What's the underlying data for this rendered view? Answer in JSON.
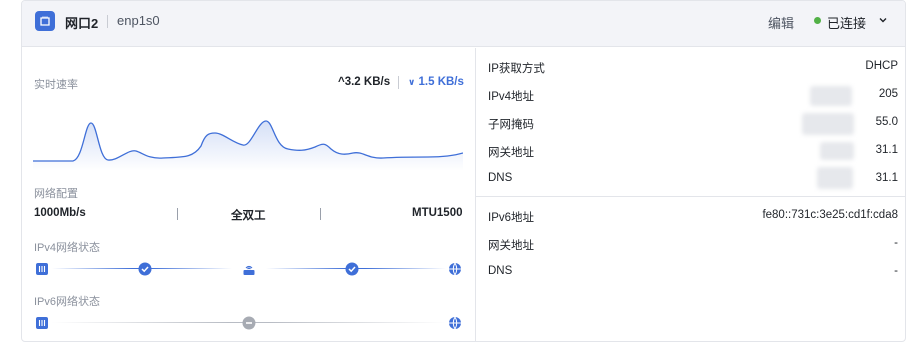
{
  "header": {
    "title": "网口2",
    "interface": "enp1s0",
    "edit_label": "编辑",
    "status_label": "已连接",
    "status_color": "#52b146",
    "accent_color": "#3f6fd8"
  },
  "speed": {
    "label": "实时速率",
    "upload": "3.2 KB/s",
    "download": "1.5 KB/s"
  },
  "config": {
    "label": "网络配置",
    "speed": "1000Mb/s",
    "duplex": "全双工",
    "mtu": "MTU1500"
  },
  "ipv4_status": {
    "label": "IPv4网络状态",
    "nodes": [
      "port-icon",
      "check-circle-icon",
      "router-icon",
      "check-circle-icon",
      "globe-icon"
    ]
  },
  "ipv6_status": {
    "label": "IPv6网络状态",
    "nodes": [
      "port-icon",
      "minus-circle-icon",
      "globe-icon"
    ]
  },
  "ipv4_info": [
    {
      "key": "IP获取方式",
      "value": "DHCP"
    },
    {
      "key": "IPv4地址",
      "value": "205"
    },
    {
      "key": "子网掩码",
      "value": "55.0"
    },
    {
      "key": "网关地址",
      "value": "31.1"
    },
    {
      "key": "DNS",
      "value": "31.1"
    }
  ],
  "ipv6_info": [
    {
      "key": "IPv6地址",
      "value": "fe80::731c:3e25:cd1f:cda8"
    },
    {
      "key": "网关地址",
      "value": "-"
    },
    {
      "key": "DNS",
      "value": "-"
    }
  ]
}
